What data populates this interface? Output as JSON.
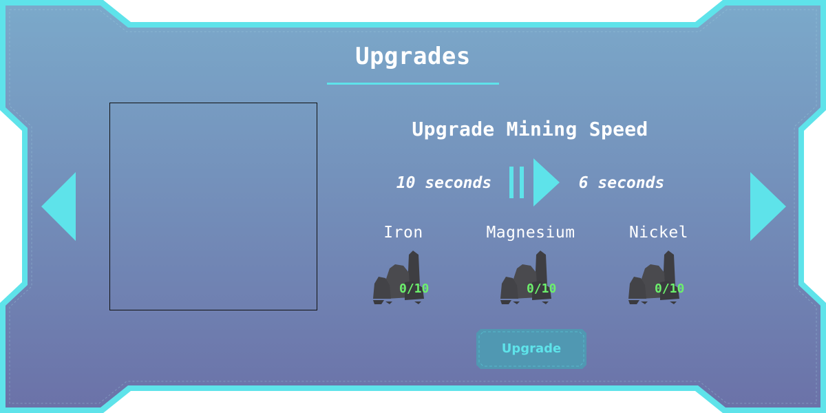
{
  "panel": {
    "title": "Upgrades",
    "colors": {
      "frame": "#5ee3ea",
      "bg_top": "#7aa8c9",
      "bg_bottom": "#6a73a8",
      "text": "#ffffff",
      "count": "#6cf06c",
      "rock": "#4a4a4e",
      "button_fill": "#4fa0b4"
    }
  },
  "upgrade": {
    "name": "Upgrade Mining Speed",
    "from_value": "10 seconds",
    "to_value": "6 seconds"
  },
  "resources": [
    {
      "name": "Iron",
      "count": "0/10",
      "icon": "ore-rock-icon"
    },
    {
      "name": "Magnesium",
      "count": "0/10",
      "icon": "ore-rock-icon"
    },
    {
      "name": "Nickel",
      "count": "0/10",
      "icon": "ore-rock-icon"
    }
  ],
  "actions": {
    "upgrade_label": "Upgrade",
    "prev_icon": "arrow-left-icon",
    "next_icon": "arrow-right-icon"
  }
}
